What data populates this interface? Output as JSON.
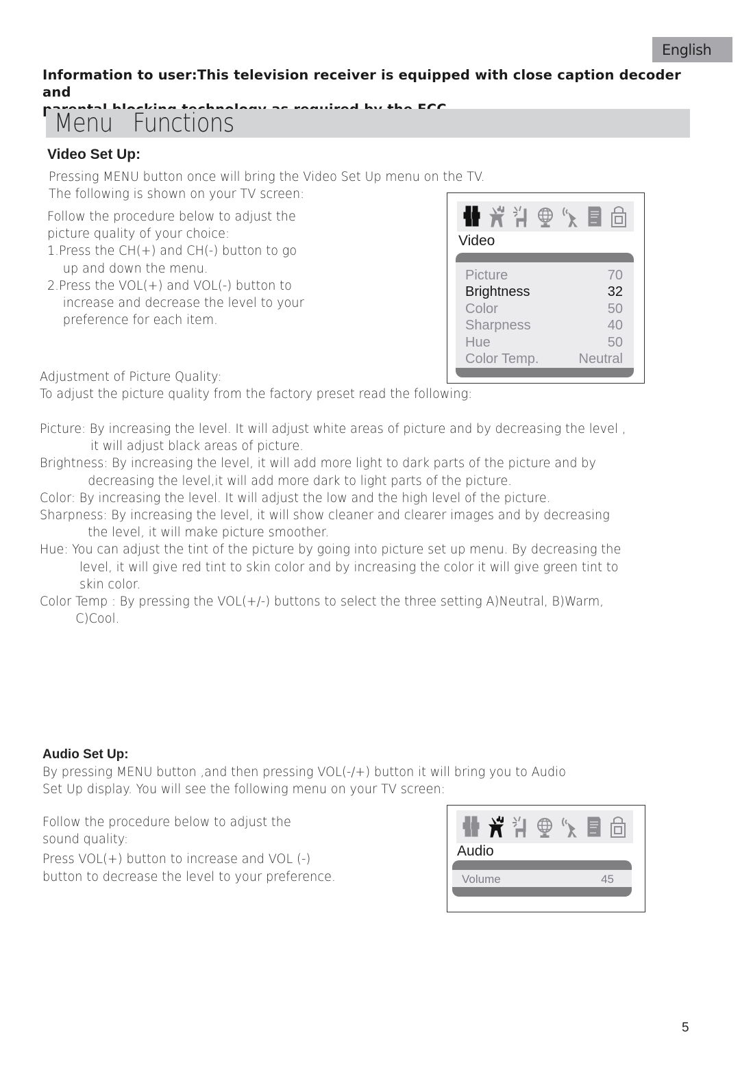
{
  "header": {
    "language_tab": "English",
    "notice": "Information to user:This television receiver is equipped with close caption decoder and parental blocking technology as required by the FCC.",
    "notice_lines": [
      "Information to user:This television receiver is equipped with close caption decoder and",
      "parental blocking technology as required by the FCC."
    ],
    "section_title": "Menu   Functions"
  },
  "video_setup": {
    "heading": "Video Set Up:",
    "intro_lines": [
      "Pressing MENU button once will bring the Video Set Up menu on the TV.",
      "The following is shown on your TV screen:"
    ],
    "procedure_lines": [
      "Follow the procedure below to adjust the",
      "picture quality of your choice:",
      "1.Press the CH(+) and CH(-) button to go",
      "up and down the menu.",
      "2.Press the VOL(+) and VOL(-) button to",
      "increase and decrease the level to your",
      "preference for each item."
    ],
    "adjustment_heading": "Adjustment of Picture Quality:",
    "adjustment_intro": "To adjust the picture quality from the factory preset read the following:",
    "descriptions": [
      {
        "lines": [
          "Picture: By increasing the level. It will adjust white areas of picture and by decreasing the level ,",
          "it will adjust black areas of picture."
        ]
      },
      {
        "lines": [
          "Brightness: By increasing the level, it will add more light to dark parts of the picture and by",
          "decreasing the level,it will add more dark to light parts of the picture."
        ]
      },
      {
        "lines": [
          "Color: By increasing the level. It will adjust  the low  and  the high level of  the picture."
        ]
      },
      {
        "lines": [
          "Sharpness: By increasing the level, it will show cleaner and clearer images and by decreasing",
          "the level, it will make picture smoother."
        ]
      },
      {
        "lines": [
          "Hue: You can adjust the tint of the picture by going into picture set up menu. By decreasing the",
          "level, it will give red tint to skin color and by increasing the color  it will give green tint to",
          "skin color."
        ]
      },
      {
        "lines": [
          "Color Temp : By pressing the VOL(+/-) buttons to select the three setting A)Neutral,  B)Warm,",
          "C)Cool."
        ]
      }
    ],
    "osd": {
      "icons": [
        "picture-icon",
        "sound-icon",
        "function-icon",
        "globe-icon",
        "antenna-icon",
        "caption-icon",
        "lock-icon"
      ],
      "active_icon": 0,
      "label": "Video",
      "rows": [
        {
          "name": "Picture",
          "value": "70"
        },
        {
          "name": "Brightness",
          "value": "32"
        },
        {
          "name": "Color",
          "value": "50"
        },
        {
          "name": "Sharpness",
          "value": "40"
        },
        {
          "name": "Hue",
          "value": "50"
        },
        {
          "name": "Color Temp.",
          "value": "Neutral"
        }
      ],
      "selected_row": 1
    }
  },
  "audio_setup": {
    "heading": "Audio Set Up:",
    "intro_lines": [
      "By pressing MENU button ,and then pressing VOL(-/+) button it will bring you to Audio",
      "Set Up display. You will see the following menu on your TV screen:"
    ],
    "procedure_lines": [
      "Follow the procedure below to adjust  the",
      "sound quality:",
      "Press VOL(+) button to increase and VOL (-)",
      "button to decrease the level to your preference."
    ],
    "osd": {
      "icons": [
        "picture-icon",
        "sound-icon",
        "function-icon",
        "globe-icon",
        "antenna-icon",
        "caption-icon",
        "lock-icon"
      ],
      "active_icon": 1,
      "label": "Audio",
      "rows": [
        {
          "name": "Volume",
          "value": "45"
        }
      ]
    }
  },
  "footer": {
    "page_number": "5"
  },
  "colors": {
    "tab_bg": "#a9a9ad",
    "title_bar_bg": "#d3d4d6",
    "osd_bar": "#7f7f82",
    "osd_list_bg": "#ebebee",
    "osd_inactive_text": "#8b8b93",
    "osd_active_text": "#141414"
  }
}
